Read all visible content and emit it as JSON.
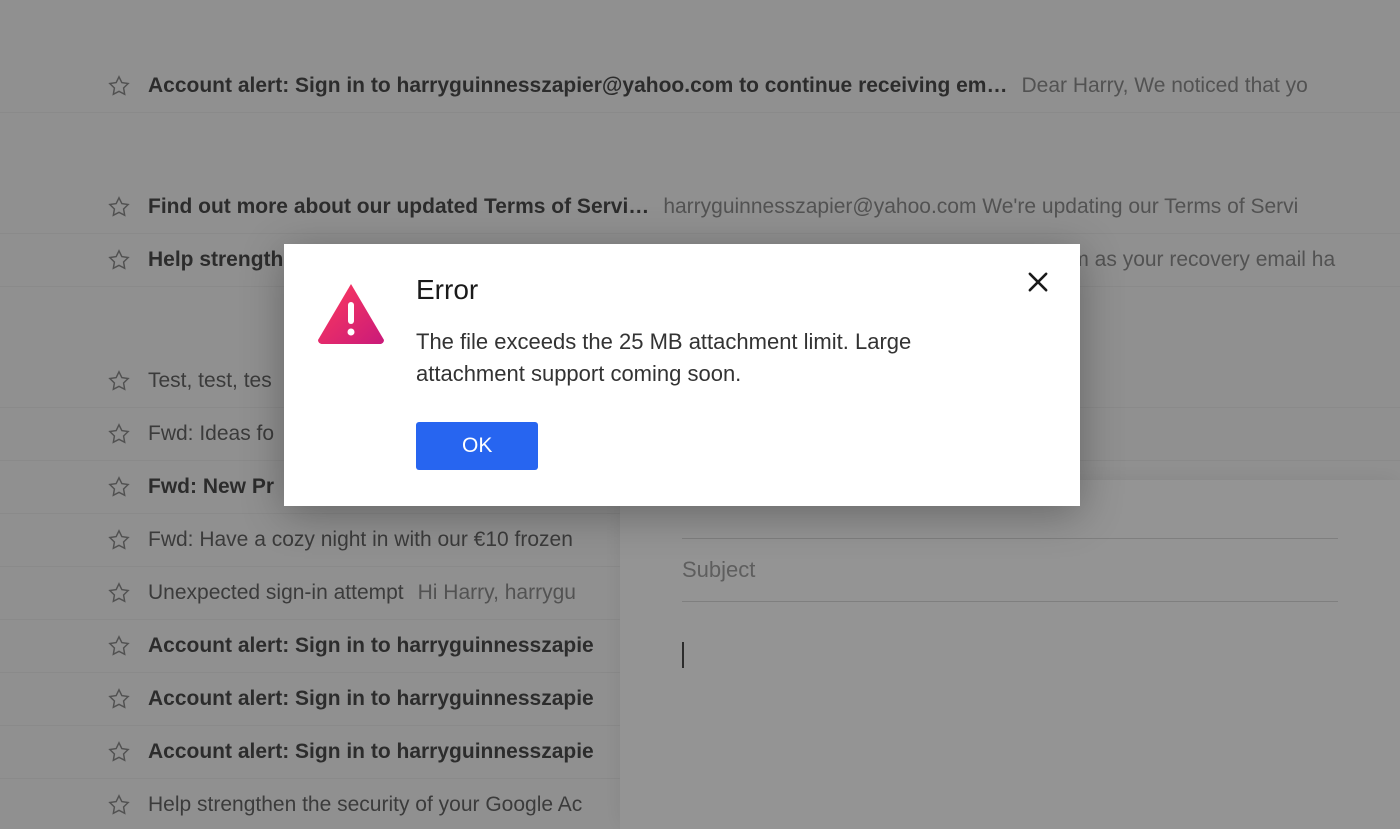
{
  "modal": {
    "title": "Error",
    "message": "The file exceeds the 25 MB attachment limit. Large attachment support coming soon.",
    "ok_label": "OK"
  },
  "compose": {
    "subject_placeholder": "Subject"
  },
  "emails": [
    {
      "subject": "Account alert: Sign in to harryguinnesszapier@yahoo.com to continue receiving em… ",
      "preview": "Dear Harry, We noticed that yo",
      "unread": true
    },
    {
      "subject": "Find out more about our updated Terms of Servi… ",
      "preview": "harryguinnesszapier@yahoo.com We're updating our Terms of Servi",
      "unread": true
    },
    {
      "subject": "Help strength",
      "preview": ".com as your recovery email ha",
      "unread": true
    },
    {
      "subject": "Test, test, tes",
      "preview": "",
      "unread": false
    },
    {
      "subject": "Fwd: Ideas fo",
      "preview": "",
      "unread": false
    },
    {
      "subject": "Fwd: New Pr",
      "preview": "",
      "unread": true
    },
    {
      "subject": "Fwd: Have a cozy night in with our €10 frozen ",
      "preview": "",
      "unread": false
    },
    {
      "subject": "Unexpected sign-in attempt ",
      "preview": "Hi Harry, harrygu",
      "unread": false
    },
    {
      "subject": "Account alert: Sign in to harryguinnesszapie",
      "preview": "",
      "unread": true
    },
    {
      "subject": "Account alert: Sign in to harryguinnesszapie",
      "preview": "",
      "unread": true
    },
    {
      "subject": "Account alert: Sign in to harryguinnesszapie",
      "preview": "",
      "unread": true
    },
    {
      "subject": "Help strengthen the security of your Google Ac",
      "preview": "",
      "unread": false
    }
  ]
}
